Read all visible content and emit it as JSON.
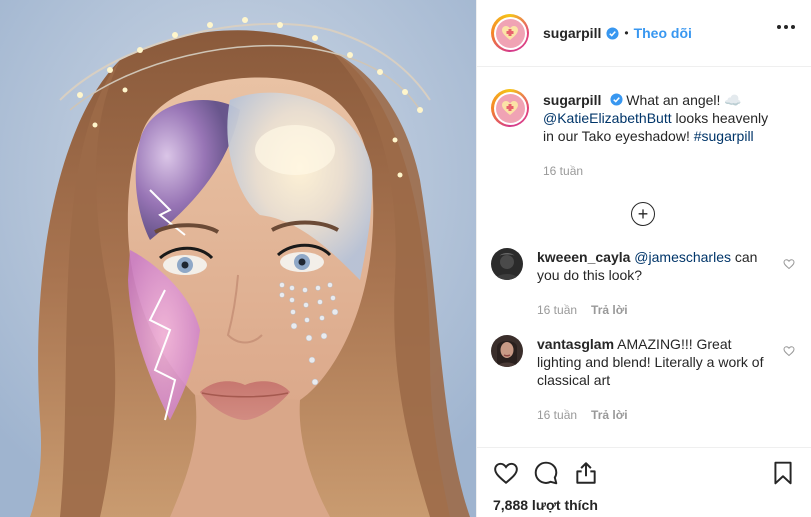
{
  "post": {
    "author": "sugarpill",
    "separator": "•",
    "follow_label": "Theo dõi"
  },
  "caption": {
    "author": "sugarpill",
    "text_intro": "What an angel! ☁️",
    "mention": "@KatieElizabethButt",
    "text_rest": " looks heavenly in our Tako eyeshadow! ",
    "hashtag": "#sugarpill",
    "time": "16 tuần"
  },
  "load_more_label": "+",
  "comments": [
    {
      "user": "kweeen_cayla",
      "mention": "@jamescharles",
      "text": " can you do this look?",
      "time": "16 tuần",
      "reply_label": "Trả lời"
    },
    {
      "user": "vantasglam",
      "mention": "",
      "text": " AMAZING!!! Great lighting and blend! Literally a work of classical art",
      "time": "16 tuần",
      "reply_label": "Trả lời"
    }
  ],
  "actions": {
    "likes": "7,888 lượt thích"
  },
  "icons": {
    "verified": "verified-badge-icon",
    "more": "more-options-icon",
    "like": "heart-icon",
    "comment": "comment-bubble-icon",
    "share": "share-upload-icon",
    "save": "bookmark-icon"
  },
  "colors": {
    "link": "#003569",
    "follow": "#3897f0",
    "meta": "#999999",
    "verified": "#3897f0"
  }
}
